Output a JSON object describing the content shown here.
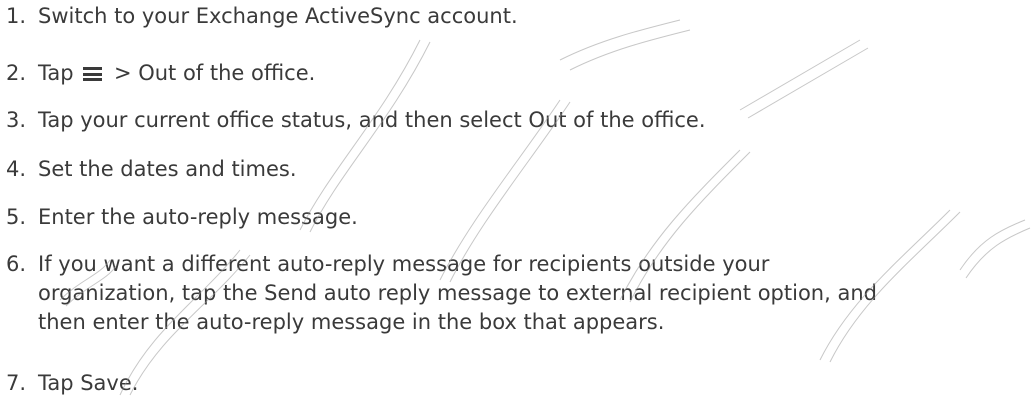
{
  "steps": [
    {
      "number": "1.",
      "text": "Switch to your Exchange ActiveSync account."
    },
    {
      "number": "2.",
      "prefix": "Tap",
      "icon": "menu-icon",
      "suffix": "> Out of the office."
    },
    {
      "number": "3.",
      "text": "Tap your current office status, and then select Out of the office."
    },
    {
      "number": "4.",
      "text": "Set the dates and times."
    },
    {
      "number": "5.",
      "text": "Enter the auto-reply message."
    },
    {
      "number": "6.",
      "lines": [
        "If you want a different auto-reply message for recipients outside your",
        "organization, tap the Send auto reply message to external recipient option, and",
        "then enter the auto-reply message in the box that appears."
      ]
    },
    {
      "number": "7.",
      "text": "Tap Save."
    }
  ],
  "watermark": {
    "text": "Confidential certification",
    "color": "#9a9a9a"
  }
}
